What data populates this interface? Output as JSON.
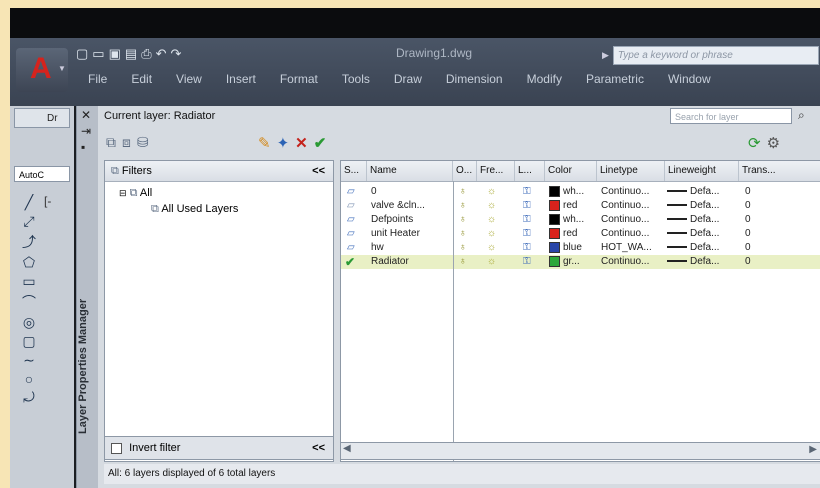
{
  "window": {
    "document_title": "Drawing1.dwg",
    "search_placeholder": "Type a keyword or phrase",
    "menu": [
      "File",
      "Edit",
      "View",
      "Insert",
      "Format",
      "Tools",
      "Draw",
      "Dimension",
      "Modify",
      "Parametric",
      "Window"
    ]
  },
  "left_side": {
    "tab_label": "Dr",
    "command_field": "AutoC",
    "draw_bracket": "[-"
  },
  "palette": {
    "title": "Layer Properties Manager"
  },
  "layer_manager": {
    "current_layer_label": "Current layer: Radiator",
    "search_placeholder": "Search for layer",
    "filters": {
      "header": "Filters",
      "collapse_glyph": "<<",
      "tree": [
        {
          "label": "All",
          "level": 0
        },
        {
          "label": "All Used Layers",
          "level": 1
        }
      ],
      "invert_filter_label": "Invert filter",
      "foot_collapse_glyph": "<<"
    },
    "columns": [
      "S...",
      "Name",
      "O...",
      "Fre...",
      "L...",
      "Color",
      "Linetype",
      "Lineweight",
      "Trans..."
    ],
    "layers": [
      {
        "name": "0",
        "color_name": "wh...",
        "color_hex": "#000000",
        "linetype": "Continuo...",
        "lineweight": "Defa...",
        "transparency": "0",
        "current": false
      },
      {
        "name": "valve &cln...",
        "color_name": "red",
        "color_hex": "#d9221c",
        "linetype": "Continuo...",
        "lineweight": "Defa...",
        "transparency": "0",
        "current": false
      },
      {
        "name": "Defpoints",
        "color_name": "wh...",
        "color_hex": "#000000",
        "linetype": "Continuo...",
        "lineweight": "Defa...",
        "transparency": "0",
        "current": false
      },
      {
        "name": "unit Heater",
        "color_name": "red",
        "color_hex": "#d9221c",
        "linetype": "Continuo...",
        "lineweight": "Defa...",
        "transparency": "0",
        "current": false
      },
      {
        "name": "hw",
        "color_name": "blue",
        "color_hex": "#2945a8",
        "linetype": "HOT_WA...",
        "lineweight": "Defa...",
        "transparency": "0",
        "current": false
      },
      {
        "name": "Radiator",
        "color_name": "gr...",
        "color_hex": "#2da83a",
        "linetype": "Continuo...",
        "lineweight": "Defa...",
        "transparency": "0",
        "current": true
      }
    ],
    "status": "All: 6 layers displayed of 6 total layers"
  }
}
